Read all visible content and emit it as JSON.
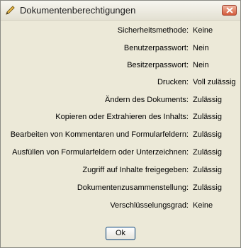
{
  "window": {
    "title": "Dokumentenberechtigungen",
    "close_label": "x"
  },
  "permissions": [
    {
      "label": "Sicherheitsmethode:",
      "value": "Keine"
    },
    {
      "label": "Benutzerpasswort:",
      "value": "Nein"
    },
    {
      "label": "Besitzerpasswort:",
      "value": "Nein"
    },
    {
      "label": "Drucken:",
      "value": "Voll zulässig"
    },
    {
      "label": "Ändern des Dokuments:",
      "value": "Zulässig"
    },
    {
      "label": "Kopieren oder Extrahieren des Inhalts:",
      "value": "Zulässig"
    },
    {
      "label": "Bearbeiten von Kommentaren und Formularfeldern:",
      "value": "Zulässig"
    },
    {
      "label": "Ausfüllen von Formularfeldern oder Unterzeichnen:",
      "value": "Zulässig"
    },
    {
      "label": "Zugriff auf Inhalte freigegeben:",
      "value": "Zulässig"
    },
    {
      "label": "Dokumentenzusammenstellung:",
      "value": "Zulässig"
    },
    {
      "label": "Verschlüsselungsgrad:",
      "value": "Keine"
    }
  ],
  "buttons": {
    "ok_label": "Ok"
  },
  "colors": {
    "dialog_bg": "#ece9d8",
    "close_button": "#d35a3b"
  }
}
